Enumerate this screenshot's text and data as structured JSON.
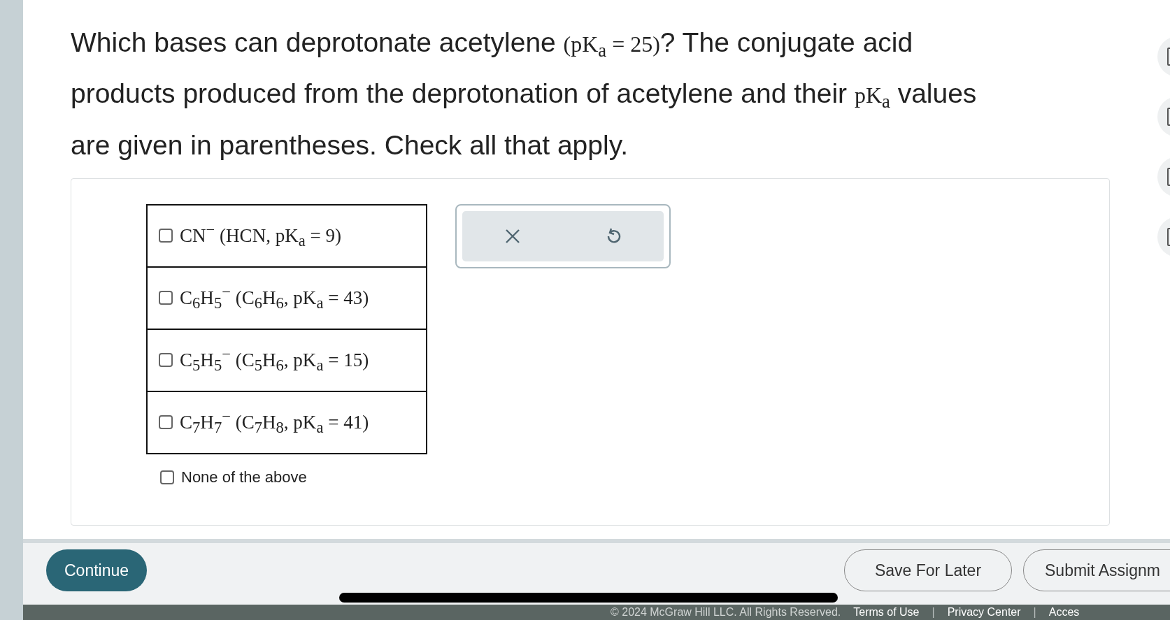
{
  "question": [
    {
      "kind": "text",
      "text": "Which bases can deprotonate acetylene "
    },
    {
      "kind": "math",
      "text": "(pK$_{a}$ = 25)"
    },
    {
      "kind": "text",
      "text": "? The conjugate acid products produced from the deprotonation of acetylene and their "
    },
    {
      "kind": "math",
      "text": "pK$_{a}$"
    },
    {
      "kind": "text",
      "text": " values are given in parentheses. Check all that apply."
    }
  ],
  "choices": [
    {
      "kind": "table-row",
      "label": "CN$^{−}$ (HCN, pK$_{a}$ = 9)",
      "checked": false
    },
    {
      "kind": "table-row",
      "label": "C$_{6}$H$_{5}$$^{−}$ (C$_{6}$H$_{6}$, pK$_{a}$ = 43)",
      "checked": false
    },
    {
      "kind": "table-row",
      "label": "C$_{5}$H$_{5}$$^{−}$ (C$_{5}$H$_{6}$, pK$_{a}$ = 15)",
      "checked": false
    },
    {
      "kind": "table-row",
      "label": "C$_{7}$H$_{7}$$^{−}$ (C$_{7}$H$_{8}$, pK$_{a}$ = 41)",
      "checked": false
    },
    {
      "kind": "plain",
      "label": "None of the above",
      "checked": false
    }
  ],
  "buttons": [
    {
      "kind": "primary",
      "label": "Continue"
    },
    {
      "kind": "outline",
      "label": "Save For Later"
    },
    {
      "kind": "outline",
      "label": "Submit Assignm"
    }
  ],
  "footer": [
    {
      "kind": "text",
      "text": "© 2024 McGraw Hill LLC. All Rights Reserved."
    },
    {
      "kind": "link",
      "text": "Terms of Use"
    },
    {
      "kind": "separator",
      "text": "|"
    },
    {
      "kind": "link",
      "text": "Privacy Center"
    },
    {
      "kind": "separator",
      "text": "|"
    },
    {
      "kind": "link",
      "text": "Acces"
    }
  ]
}
